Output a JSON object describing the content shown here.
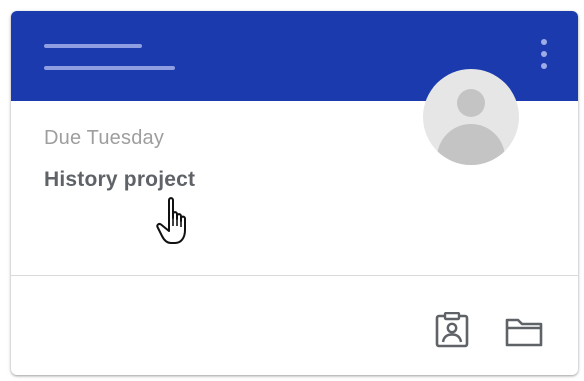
{
  "card": {
    "due_label": "Due Tuesday",
    "title": "History project"
  },
  "icons": {
    "menu": "more-vert-icon",
    "avatar": "person-icon",
    "portfolio": "student-portfolio-icon",
    "folder": "folder-icon",
    "cursor": "hand-pointer-icon"
  },
  "colors": {
    "header": "#1a3aad",
    "header_accent": "#8e9ee0",
    "due_text": "#9e9e9e",
    "title_text": "#5f6368",
    "avatar_bg": "#e6e6e6",
    "avatar_fg": "#c4c4c4",
    "icon": "#5f6368"
  }
}
